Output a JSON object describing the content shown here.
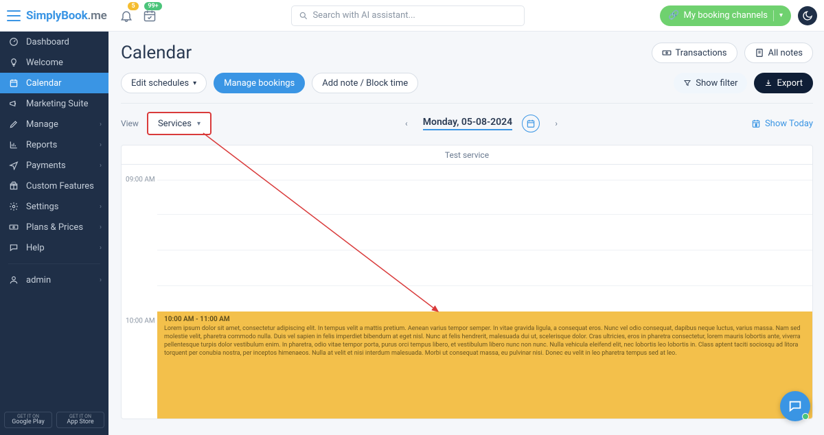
{
  "topbar": {
    "logo_main": "Simply",
    "logo_bold": "Book",
    "logo_suffix": ".me",
    "bell_badge": "5",
    "cal_badge": "99+",
    "search_placeholder": "Search with AI assistant...",
    "booking_channels": "My booking channels"
  },
  "sidebar": {
    "items": [
      {
        "label": "Dashboard",
        "icon": "gauge"
      },
      {
        "label": "Welcome",
        "icon": "bulb"
      },
      {
        "label": "Calendar",
        "icon": "calendar",
        "active": true
      },
      {
        "label": "Marketing Suite",
        "icon": "megaphone"
      },
      {
        "label": "Manage",
        "icon": "pencil",
        "chev": true
      },
      {
        "label": "Reports",
        "icon": "chart",
        "chev": true
      },
      {
        "label": "Payments",
        "icon": "send",
        "chev": true
      },
      {
        "label": "Custom Features",
        "icon": "gift"
      },
      {
        "label": "Settings",
        "icon": "gear",
        "chev": true
      },
      {
        "label": "Plans & Prices",
        "icon": "cash",
        "chev": true
      },
      {
        "label": "Help",
        "icon": "chat",
        "chev": true
      }
    ],
    "admin_label": "admin",
    "store1_small": "GET IT ON",
    "store1_big": "Google Play",
    "store2_small": "GET IT ON",
    "store2_big": "App Store"
  },
  "page": {
    "title": "Calendar",
    "transactions": "Transactions",
    "all_notes": "All notes",
    "edit_schedules": "Edit schedules",
    "manage_bookings": "Manage bookings",
    "add_note": "Add note / Block time",
    "show_filter": "Show filter",
    "export": "Export",
    "view_label": "View",
    "services": "Services",
    "date": "Monday, 05-08-2024",
    "show_today": "Show Today"
  },
  "calendar": {
    "column_header": "Test service",
    "time_0900": "09:00 AM",
    "time_1000": "10:00 AM",
    "event_time": "10:00 AM - 11:00 AM",
    "event_desc": "Lorem ipsum dolor sit amet, consectetur adipiscing elit. In tempus velit a mattis pretium. Aenean varius tempor semper. In vitae gravida ligula, a consequat eros. Nunc vel odio consequat, dapibus neque luctus, varius massa. Nam sed molestie velit, pharetra commodo nulla. Duis vel sapien in felis imperdiet bibendum at eget nisl. Nunc at felis hendrerit, malesuada dui ut, scelerisque dolor. Cras ultricies, eros in pharetra consectetur, lorem mauris lobortis ante, viverra pellentesque turpis dolor vestibulum enim. In pharetra, odio vitae tempor porta, purus orci tempus libero, et vestibulum libero nunc non nunc. Nulla vehicula eleifend elit, nec lobortis leo lobortis in. Class aptent taciti sociosqu ad litora torquent per conubia nostra, per inceptos himenaeos. Nulla at velit et nisi interdum malesuada. Morbi ut consequat massa, eu pulvinar nisi. Donec eu velit in leo pharetra tempus sed at leo."
  }
}
